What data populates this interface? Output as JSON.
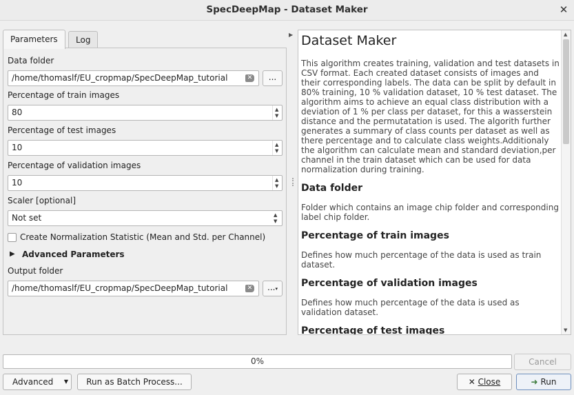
{
  "window": {
    "title": "SpecDeepMap - Dataset Maker"
  },
  "tabs": [
    {
      "label": "Parameters"
    },
    {
      "label": "Log"
    }
  ],
  "params": {
    "data_folder": {
      "label": "Data folder",
      "value": "/home/thomaslf/EU_cropmap/SpecDeepMap_tutorial",
      "browse_label": "..."
    },
    "train": {
      "label": "Percentage of train images",
      "value": "80"
    },
    "test": {
      "label": "Percentage of test images",
      "value": "10"
    },
    "validation": {
      "label": "Percentage of validation images",
      "value": "10"
    },
    "scaler": {
      "label": "Scaler [optional]",
      "value": "Not set"
    },
    "normalization": {
      "label": "Create Normalization Statistic (Mean and Std. per Channel)",
      "checked": false
    },
    "advanced": {
      "label": "Advanced Parameters"
    },
    "output_folder": {
      "label": "Output folder",
      "value": "/home/thomaslf/EU_cropmap/SpecDeepMap_tutorial",
      "browse_label": "..."
    }
  },
  "help": {
    "title": "Dataset Maker",
    "intro": "This algorithm creates training, validation and test datasets in CSV format. Each created dataset consists of images and their corresponding labels. The data can be split by default in 80% training, 10 % validation dataset, 10 % test dataset. The algorithm aims to achieve an equal class distribution with a deviation of 1 % per class per dataset, for this a wasserstein distance and the permutatation is used. The algorith further generates a summary of class counts per dataset as well as there percentage and to calculate class weights.Additionaly the algorithm can calculate mean and standard deviation,per channel in the train dataset which can be used for data normalization during training.",
    "sections": [
      {
        "heading": "Data folder",
        "text": "Folder which contains an image chip folder and corresponding label chip folder."
      },
      {
        "heading": "Percentage of train images",
        "text": "Defines how much percentage of the data is used as train dataset."
      },
      {
        "heading": "Percentage of validation images",
        "text": "Defines how much percentage of the data is used as validation dataset."
      },
      {
        "heading": "Percentage of test images",
        "text": ""
      }
    ]
  },
  "progress": {
    "text": "0%",
    "fraction": 0.0
  },
  "buttons": {
    "cancel": "Cancel",
    "advanced": "Advanced",
    "batch": "Run as Batch Process...",
    "close": "Close",
    "run": "Run"
  }
}
